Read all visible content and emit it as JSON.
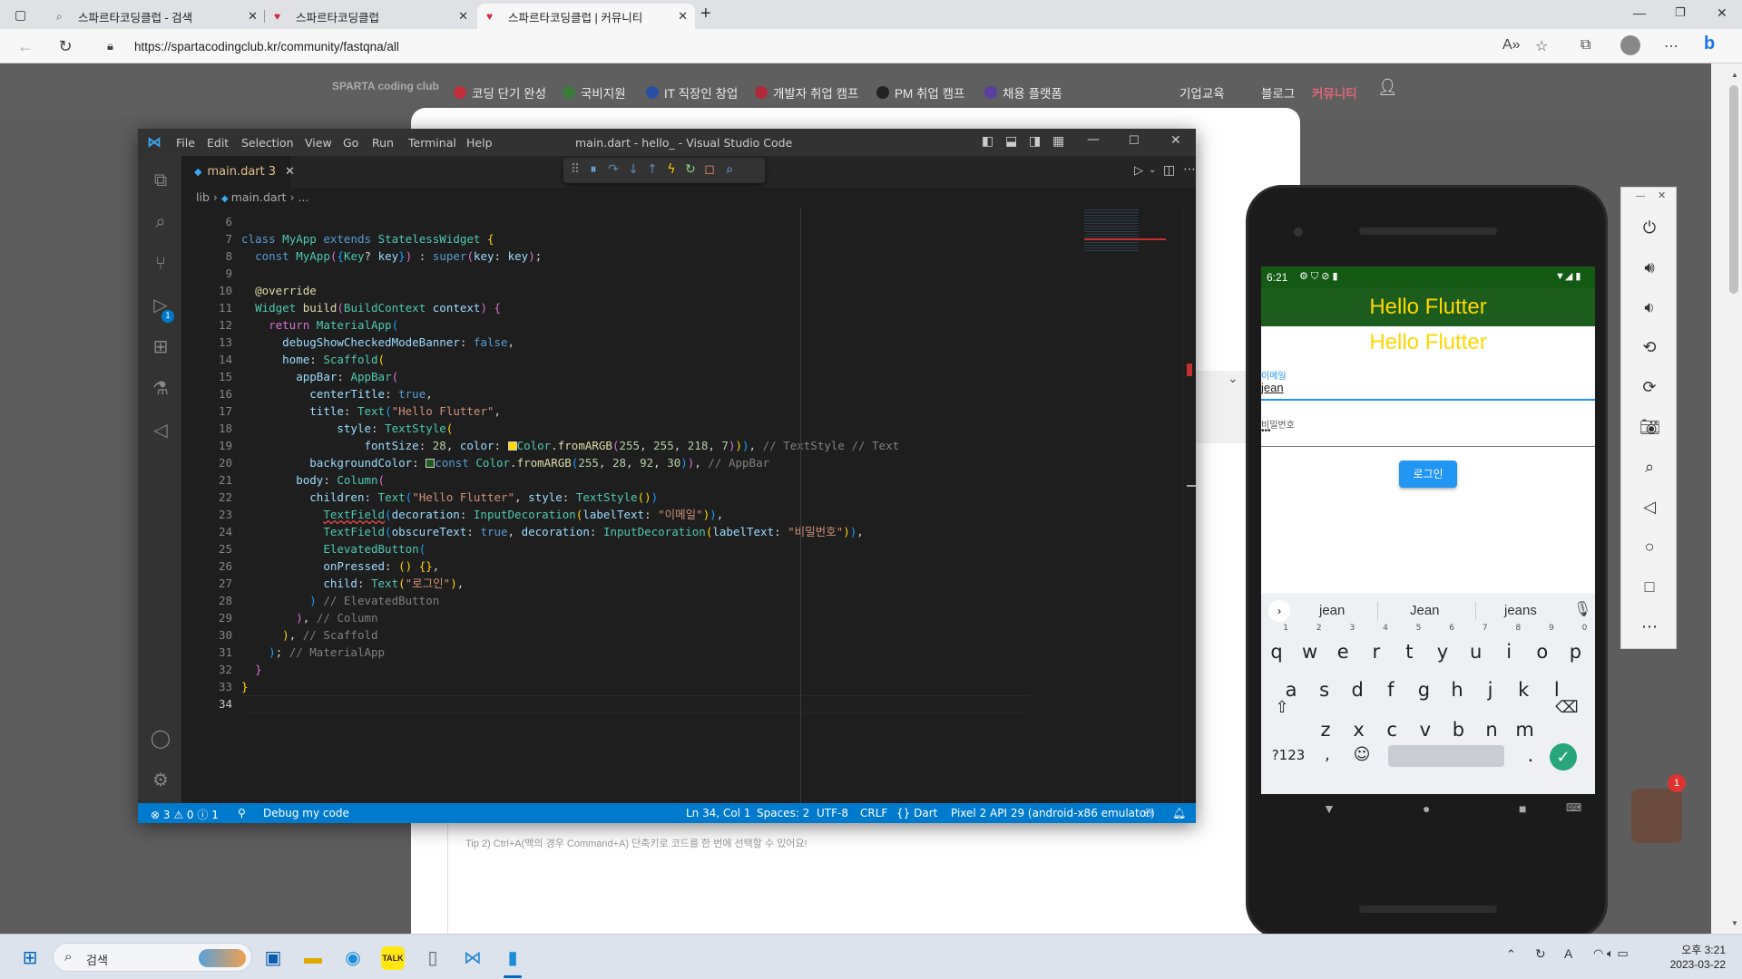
{
  "browser": {
    "tabs": [
      {
        "label": "스파르타코딩클럽 - 검색",
        "icon": "search-icon"
      },
      {
        "label": "스파르타코딩클럽",
        "icon": "sparta-icon"
      },
      {
        "label": "스파르타코딩클럽 | 커뮤니티",
        "icon": "sparta-icon"
      }
    ],
    "url": "https://spartacodingclub.kr/community/fastqna/all"
  },
  "website": {
    "logo": "SPARTA coding club",
    "nav": [
      "코딩 단기 완성",
      "국비지원",
      "IT 직장인 창업",
      "개발자 취업 캠프",
      "PM 취업 캠프",
      "채용 플랫폼"
    ],
    "right_nav": [
      "기업교육",
      "블로그",
      "커뮤니티"
    ],
    "tip_text": "Tip 2) Ctrl+A(맥의 경우 Command+A) 단축키로 코드를 한 번에 선택할 수 있어요!"
  },
  "vscode": {
    "title": "main.dart - hello_ - Visual Studio Code",
    "menu": [
      "File",
      "Edit",
      "Selection",
      "View",
      "Go",
      "Run",
      "Terminal",
      "Help"
    ],
    "tab": {
      "name": "main.dart",
      "problems": "3"
    },
    "breadcrumb": [
      "lib",
      "main.dart",
      "..."
    ],
    "line_numbers": [
      "6",
      "7",
      "8",
      "9",
      "10",
      "11",
      "12",
      "13",
      "14",
      "15",
      "16",
      "17",
      "18",
      "19",
      "20",
      "21",
      "22",
      "23",
      "24",
      "25",
      "26",
      "27",
      "28",
      "29",
      "30",
      "31",
      "32",
      "33",
      "34"
    ],
    "debug_badge": "1",
    "status": {
      "errors": "3",
      "warnings": "0",
      "infos": "1",
      "debug": "Debug my code",
      "position": "Ln 34, Col 1",
      "spaces": "Spaces: 2",
      "encoding": "UTF-8",
      "eol": "CRLF",
      "language": "Dart",
      "device": "Pixel 2 API 29 (android-x86 emulator)"
    }
  },
  "emulator": {
    "time": "6:21",
    "appbar_title": "Hello Flutter",
    "body_title": "Hello Flutter",
    "email_label": "이메일",
    "email_value": "jean",
    "password_label": "비밀번호",
    "password_value": "•••",
    "login_button": "로그인",
    "suggestions": [
      "jean",
      "Jean",
      "jeans"
    ],
    "row1": [
      "q",
      "w",
      "e",
      "r",
      "t",
      "y",
      "u",
      "i",
      "o",
      "p"
    ],
    "row1_nums": [
      "1",
      "2",
      "3",
      "4",
      "5",
      "6",
      "7",
      "8",
      "9",
      "0"
    ],
    "row2": [
      "a",
      "s",
      "d",
      "f",
      "g",
      "h",
      "j",
      "k",
      "l"
    ],
    "row3": [
      "z",
      "x",
      "c",
      "v",
      "b",
      "n",
      "m"
    ],
    "symbols_key": "?123",
    "comma": ",",
    "period": "."
  },
  "taskbar": {
    "search_placeholder": "검색",
    "time": "오후 3:21",
    "date": "2023-03-22"
  },
  "colors": {
    "vscode_blue": "#007acc",
    "appbar_green": "#1c5c1c",
    "title_yellow": "#ffd700",
    "button_blue": "#2196f3"
  }
}
